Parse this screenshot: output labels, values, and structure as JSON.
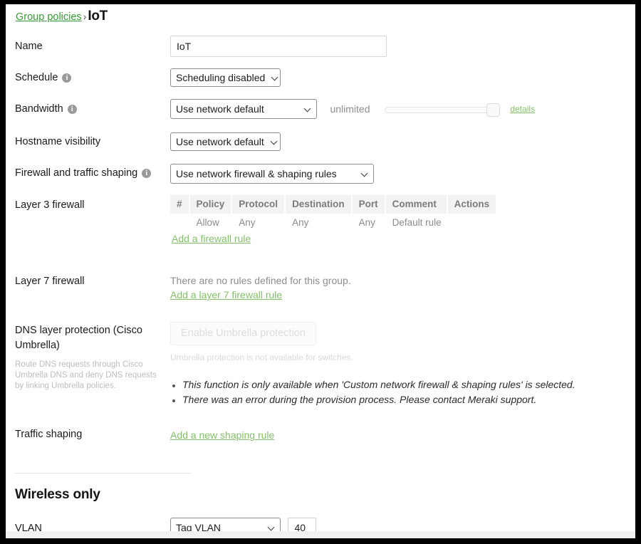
{
  "breadcrumb": {
    "parent": "Group policies",
    "separator": "›",
    "current": "IoT"
  },
  "form": {
    "name": {
      "label": "Name",
      "value": "IoT",
      "placeholder": ""
    },
    "schedule": {
      "label": "Schedule",
      "has_info": true,
      "value": "Scheduling disabled"
    },
    "bandwidth": {
      "label": "Bandwidth",
      "has_info": true,
      "value": "Use network default",
      "limit_text": "unlimited",
      "details_link": "details",
      "slider_position_percent": 100
    },
    "hostname_visibility": {
      "label": "Hostname visibility",
      "value": "Use network default"
    },
    "firewall_traffic_shaping": {
      "label": "Firewall and traffic shaping",
      "has_info": true,
      "value": "Use network firewall & shaping rules"
    },
    "layer3_firewall": {
      "label": "Layer 3 firewall",
      "columns": [
        "#",
        "Policy",
        "Protocol",
        "Destination",
        "Port",
        "Comment",
        "Actions"
      ],
      "rows": [
        {
          "num": "",
          "policy": "Allow",
          "protocol": "Any",
          "destination": "Any",
          "port": "Any",
          "comment": "Default rule",
          "actions": ""
        }
      ],
      "add_link": "Add a firewall rule"
    },
    "layer7_firewall": {
      "label": "Layer 7 firewall",
      "empty_text": "There are no rules defined for this group.",
      "add_link": "Add a layer 7 firewall rule"
    },
    "dns_layer_protection": {
      "label": "DNS layer protection (Cisco Umbrella)",
      "helper": "Route DNS requests through Cisco Umbrella DNS and deny DNS requests by linking Umbrella policies.",
      "button_label": "Enable Umbrella protection",
      "button_disabled": true,
      "unavailable_text": "Umbrella protection is not available for switches.",
      "notes": [
        "This function is only available when 'Custom network firewall & shaping rules' is selected.",
        "There was an error during the provision process. Please contact Meraki support."
      ]
    },
    "traffic_shaping": {
      "label": "Traffic shaping",
      "add_link": "Add a new shaping rule"
    }
  },
  "wireless_only": {
    "title": "Wireless only",
    "vlan": {
      "label": "VLAN",
      "mode": "Tag VLAN",
      "tag": "40"
    }
  },
  "colors": {
    "link_green": "#84c06a",
    "breadcrumb_green": "#3a9b35",
    "text": "#1a1a1a",
    "muted": "#8b8b8b",
    "table_header_bg": "#f3f3f3"
  }
}
